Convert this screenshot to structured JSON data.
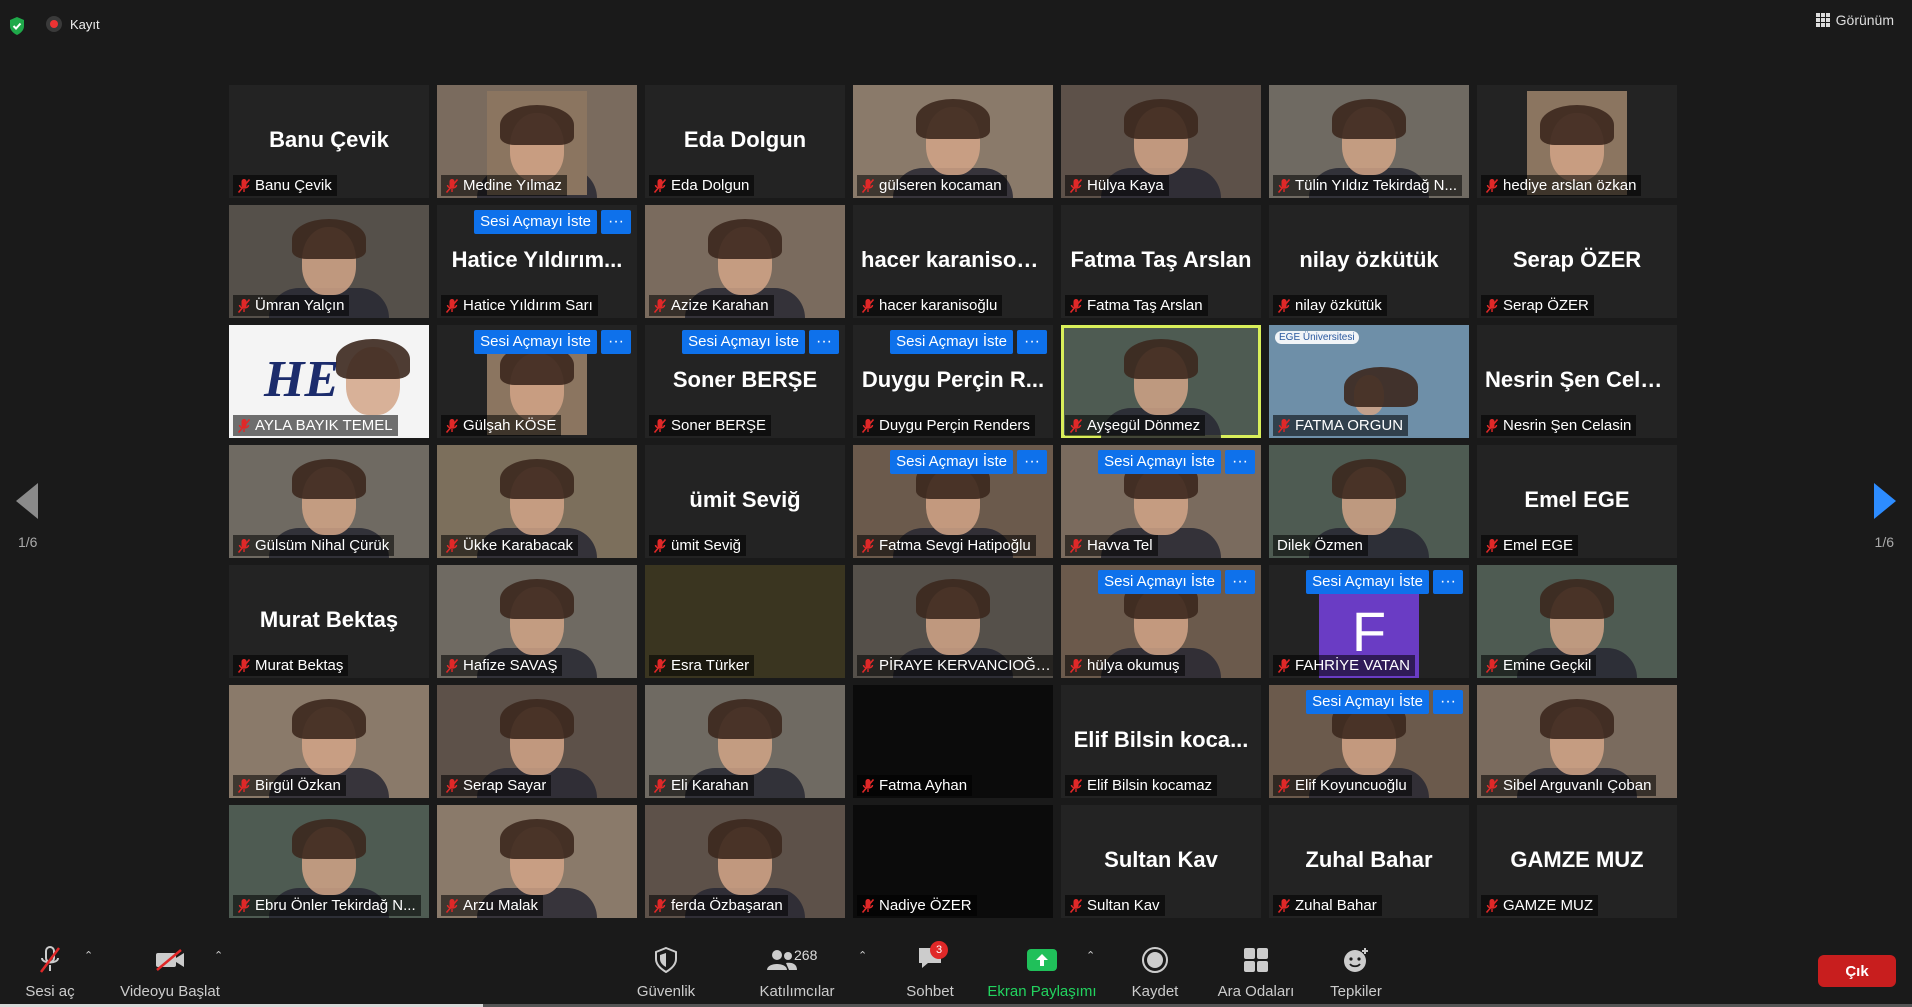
{
  "topbar": {
    "recording_label": "Kayıt",
    "view_label": "Görünüm"
  },
  "navigation": {
    "page_left": "1/6",
    "page_right": "1/6"
  },
  "participants": [
    {
      "name": "Banu Çevik",
      "big": "Banu Çevik",
      "video": false,
      "ask": false
    },
    {
      "name": "Medine Yılmaz",
      "big": "",
      "video": true,
      "ask": false,
      "avatar": true
    },
    {
      "name": "Eda Dolgun",
      "big": "Eda Dolgun",
      "video": false,
      "ask": false
    },
    {
      "name": "gülseren kocaman",
      "big": "",
      "video": true,
      "ask": false
    },
    {
      "name": "Hülya Kaya",
      "big": "",
      "video": true,
      "ask": false
    },
    {
      "name": "Tülin Yıldız Tekirdağ N...",
      "big": "",
      "video": true,
      "ask": false
    },
    {
      "name": "hediye arslan özkan",
      "big": "",
      "video": false,
      "ask": false,
      "avatar": true
    },
    {
      "name": "Ümran Yalçın",
      "big": "",
      "video": true,
      "ask": false
    },
    {
      "name": "Hatice Yıldırım Sarı",
      "big": "Hatice  Yıldırım...",
      "video": false,
      "ask": true
    },
    {
      "name": "Azize Karahan",
      "big": "",
      "video": true,
      "ask": false
    },
    {
      "name": "hacer karanisoğlu",
      "big": "hacer karanisoğlu",
      "video": false,
      "ask": false
    },
    {
      "name": "Fatma Taş Arslan",
      "big": "Fatma Taş Arslan",
      "video": false,
      "ask": false
    },
    {
      "name": "nilay özkütük",
      "big": "nilay özkütük",
      "video": false,
      "ask": false
    },
    {
      "name": "Serap ÖZER",
      "big": "Serap ÖZER",
      "video": false,
      "ask": false
    },
    {
      "name": "AYLA BAYIK TEMEL",
      "big": "",
      "video": true,
      "ask": false,
      "logo": "HE"
    },
    {
      "name": "Gülşah KÖSE",
      "big": "",
      "video": false,
      "ask": true,
      "avatar": true
    },
    {
      "name": "Soner BERŞE",
      "big": "Soner BERŞE",
      "video": false,
      "ask": true
    },
    {
      "name": "Duygu Perçin Renders",
      "big": "Duygu Perçin R...",
      "video": false,
      "ask": true
    },
    {
      "name": "Ayşegül Dönmez",
      "big": "",
      "video": true,
      "ask": false,
      "active": true
    },
    {
      "name": "FATMA ORGUN",
      "big": "",
      "video": true,
      "ask": false,
      "ege": "EGE Üniversitesi"
    },
    {
      "name": "Nesrin Şen Celasin",
      "big": "Nesrin Şen Cela...",
      "video": false,
      "ask": false
    },
    {
      "name": "Gülsüm Nihal Çürük",
      "big": "",
      "video": true,
      "ask": false
    },
    {
      "name": "Ükke Karabacak",
      "big": "",
      "video": true,
      "ask": false
    },
    {
      "name": "ümit Seviğ",
      "big": "ümit Seviğ",
      "video": false,
      "ask": false
    },
    {
      "name": "Fatma Sevgi Hatipoğlu",
      "big": "",
      "video": true,
      "ask": true
    },
    {
      "name": "Havva Tel",
      "big": "",
      "video": true,
      "ask": true
    },
    {
      "name": "Dilek Özmen",
      "big": "",
      "video": true,
      "ask": false,
      "nomute": true
    },
    {
      "name": "Emel EGE",
      "big": "Emel EGE",
      "video": false,
      "ask": false
    },
    {
      "name": "Murat Bektaş",
      "big": "Murat Bektaş",
      "video": false,
      "ask": false
    },
    {
      "name": "Hafize SAVAŞ",
      "big": "",
      "video": true,
      "ask": false
    },
    {
      "name": "Esra Türker",
      "big": "",
      "video": true,
      "ask": false,
      "dim": true
    },
    {
      "name": "PİRAYE KERVANCIOĞLU",
      "big": "",
      "video": true,
      "ask": false
    },
    {
      "name": "hülya okumuş",
      "big": "",
      "video": true,
      "ask": true
    },
    {
      "name": "FAHRİYE VATAN",
      "big": "",
      "video": false,
      "ask": true,
      "letter": "F"
    },
    {
      "name": "Emine Geçkil",
      "big": "",
      "video": true,
      "ask": false
    },
    {
      "name": "Birgül Özkan",
      "big": "",
      "video": true,
      "ask": false
    },
    {
      "name": "Serap Sayar",
      "big": "",
      "video": true,
      "ask": false
    },
    {
      "name": "Eli Karahan",
      "big": "",
      "video": true,
      "ask": false
    },
    {
      "name": "Fatma Ayhan",
      "big": "",
      "video": true,
      "ask": false,
      "black": true
    },
    {
      "name": "Elif Bilsin kocamaz",
      "big": "Elif Bilsin koca...",
      "video": false,
      "ask": false
    },
    {
      "name": "Elif Koyuncuoğlu",
      "big": "",
      "video": true,
      "ask": true
    },
    {
      "name": "Sibel Arguvanlı Çoban",
      "big": "",
      "video": true,
      "ask": false
    },
    {
      "name": "Ebru Önler Tekirdağ N...",
      "big": "",
      "video": true,
      "ask": false
    },
    {
      "name": "Arzu Malak",
      "big": "",
      "video": true,
      "ask": false
    },
    {
      "name": "ferda Özbaşaran",
      "big": "",
      "video": true,
      "ask": false
    },
    {
      "name": "Nadiye ÖZER",
      "big": "",
      "video": true,
      "ask": false,
      "black": true
    },
    {
      "name": "Sultan Kav",
      "big": "Sultan Kav",
      "video": false,
      "ask": false
    },
    {
      "name": "Zuhal Bahar",
      "big": "Zuhal Bahar",
      "video": false,
      "ask": false
    },
    {
      "name": "GAMZE MUZ",
      "big": "GAMZE MUZ",
      "video": false,
      "ask": false
    }
  ],
  "ask_label": "Sesi Açmayı İste",
  "more_label": "···",
  "toolbar": {
    "unmute": "Sesi aç",
    "start_video": "Videoyu Başlat",
    "security": "Güvenlik",
    "participants": "Katılımcılar",
    "participants_count": "268",
    "chat": "Sohbet",
    "chat_badge": "3",
    "share": "Ekran Paylaşımı",
    "record": "Kaydet",
    "breakout": "Ara Odaları",
    "reactions": "Tepkiler",
    "leave": "Çık"
  },
  "colors": {
    "accent": "#0e71eb",
    "share_green": "#20c05a",
    "leave_red": "#c81e1e",
    "active_speaker": "#d9ef5a"
  }
}
